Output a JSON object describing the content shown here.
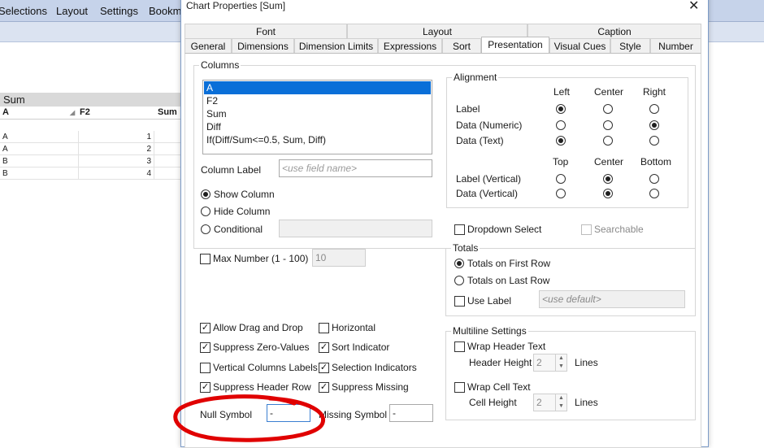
{
  "app": {
    "menu": [
      "Selections",
      "Layout",
      "Settings",
      "Bookm"
    ],
    "table": {
      "title": "Sum",
      "headers": [
        "A",
        "F2",
        "Sum"
      ],
      "rows": [
        [
          "A",
          "1"
        ],
        [
          "A",
          "2"
        ],
        [
          "B",
          "3"
        ],
        [
          "B",
          "4"
        ]
      ]
    }
  },
  "dialog": {
    "title": "Chart Properties [Sum]",
    "tabs_row1": [
      "Font",
      "Layout",
      "Caption"
    ],
    "tabs_row2": [
      "General",
      "Dimensions",
      "Dimension Limits",
      "Expressions",
      "Sort",
      "Presentation",
      "Visual Cues",
      "Style",
      "Number"
    ],
    "active_tab": "Presentation",
    "columns": {
      "title": "Columns",
      "items": [
        "A",
        "F2",
        "Sum",
        "Diff",
        "If(Diff/Sum<=0.5, Sum, Diff)"
      ],
      "selected_index": 0,
      "column_label": "Column Label",
      "column_label_placeholder": "<use field name>",
      "show_column": "Show Column",
      "hide_column": "Hide Column",
      "conditional": "Conditional",
      "visibility": "Show Column"
    },
    "alignment": {
      "title": "Alignment",
      "h_headers": [
        "Left",
        "Center",
        "Right"
      ],
      "h_rows": [
        {
          "label": "Label",
          "selected": 0
        },
        {
          "label": "Data (Numeric)",
          "selected": 2
        },
        {
          "label": "Data (Text)",
          "selected": 0
        }
      ],
      "v_headers": [
        "Top",
        "Center",
        "Bottom"
      ],
      "v_rows": [
        {
          "label": "Label (Vertical)",
          "selected": 1
        },
        {
          "label": "Data (Vertical)",
          "selected": 1
        }
      ]
    },
    "dropdown_select": "Dropdown Select",
    "searchable": "Searchable",
    "max_number": {
      "label": "Max Number (1 - 100)",
      "value": "10"
    },
    "totals": {
      "title": "Totals",
      "first_row": "Totals on First Row",
      "last_row": "Totals on Last Row",
      "use_label": "Use Label",
      "use_label_placeholder": "<use default>",
      "selected": "first"
    },
    "options": {
      "allow_drag": "Allow Drag and Drop",
      "suppress_zero": "Suppress Zero-Values",
      "vertical_labels": "Vertical Columns Labels",
      "suppress_header": "Suppress Header Row",
      "horizontal": "Horizontal",
      "sort_indicator": "Sort Indicator",
      "selection_indicators": "Selection Indicators",
      "suppress_missing": "Suppress Missing"
    },
    "null_symbol": {
      "label": "Null Symbol",
      "value": "-"
    },
    "missing_symbol": {
      "label": "Missing Symbol",
      "value": "-"
    },
    "multiline": {
      "title": "Multiline Settings",
      "wrap_header": "Wrap Header Text",
      "header_height": "Header Height",
      "header_value": "2",
      "lines1": "Lines",
      "wrap_cell": "Wrap Cell Text",
      "cell_height": "Cell Height",
      "cell_value": "2",
      "lines2": "Lines"
    },
    "colors": {
      "accent": "#0a6fd8",
      "annotation": "#e00000"
    }
  }
}
